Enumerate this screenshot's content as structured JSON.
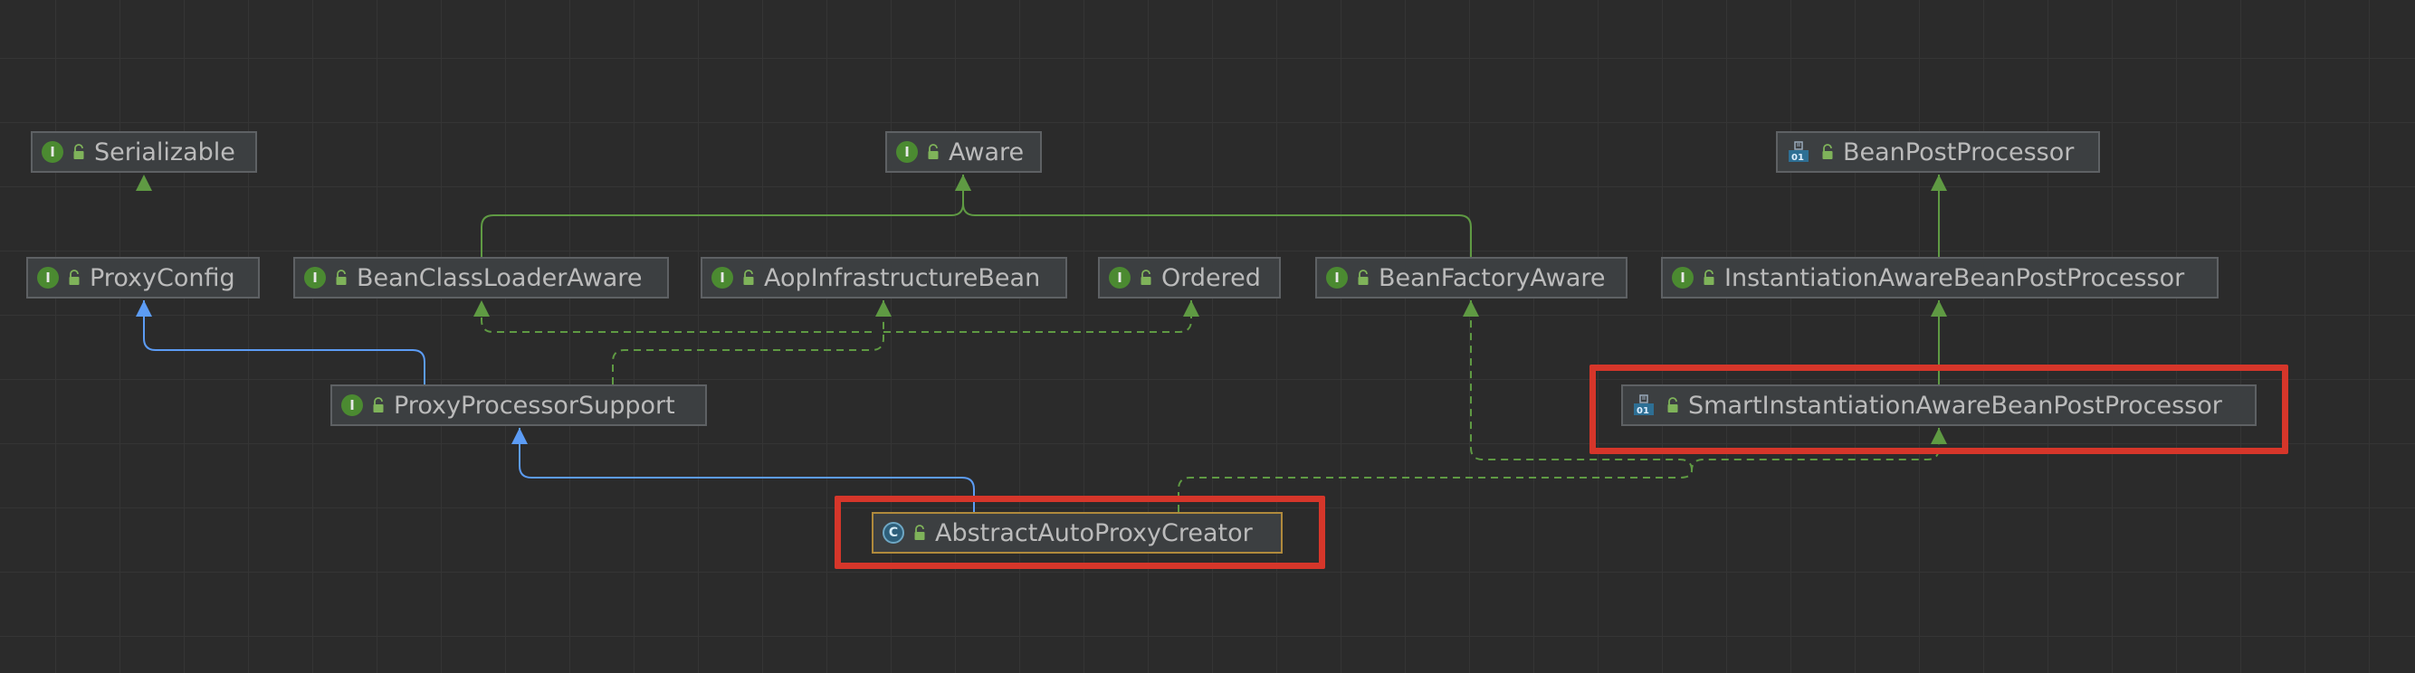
{
  "diagram": {
    "nodes": [
      {
        "id": "serializable",
        "label": "Serializable",
        "kind": "interface-icon"
      },
      {
        "id": "aware",
        "label": "Aware",
        "kind": "interface-icon"
      },
      {
        "id": "bean-post-processor",
        "label": "BeanPostProcessor",
        "kind": "functional-interface-icon"
      },
      {
        "id": "proxy-config",
        "label": "ProxyConfig",
        "kind": "interface-icon"
      },
      {
        "id": "bean-class-loader-aware",
        "label": "BeanClassLoaderAware",
        "kind": "interface-icon"
      },
      {
        "id": "aop-infrastructure-bean",
        "label": "AopInfrastructureBean",
        "kind": "interface-icon"
      },
      {
        "id": "ordered",
        "label": "Ordered",
        "kind": "interface-icon"
      },
      {
        "id": "bean-factory-aware",
        "label": "BeanFactoryAware",
        "kind": "interface-icon"
      },
      {
        "id": "instantiation-aware-bean-post-processor",
        "label": "InstantiationAwareBeanPostProcessor",
        "kind": "interface-icon"
      },
      {
        "id": "proxy-processor-support",
        "label": "ProxyProcessorSupport",
        "kind": "interface-icon"
      },
      {
        "id": "smart-instantiation-aware-bean-post-processor",
        "label": "SmartInstantiationAwareBeanPostProcessor",
        "kind": "functional-interface-icon"
      },
      {
        "id": "abstract-auto-proxy-creator",
        "label": "AbstractAutoProxyCreator",
        "kind": "abstract-class-icon"
      }
    ],
    "edges": [
      {
        "from": "proxy-config",
        "to": "serializable",
        "type": "implements"
      },
      {
        "from": "bean-class-loader-aware",
        "to": "aware",
        "type": "extends-interface"
      },
      {
        "from": "bean-factory-aware",
        "to": "aware",
        "type": "extends-interface"
      },
      {
        "from": "instantiation-aware-bean-post-processor",
        "to": "bean-post-processor",
        "type": "extends-interface"
      },
      {
        "from": "smart-instantiation-aware-bean-post-processor",
        "to": "instantiation-aware-bean-post-processor",
        "type": "extends-interface"
      },
      {
        "from": "proxy-processor-support",
        "to": "proxy-config",
        "type": "extends-class"
      },
      {
        "from": "proxy-processor-support",
        "to": "bean-class-loader-aware",
        "type": "implements"
      },
      {
        "from": "proxy-processor-support",
        "to": "aop-infrastructure-bean",
        "type": "implements"
      },
      {
        "from": "proxy-processor-support",
        "to": "ordered",
        "type": "implements"
      },
      {
        "from": "abstract-auto-proxy-creator",
        "to": "proxy-processor-support",
        "type": "extends-class"
      },
      {
        "from": "abstract-auto-proxy-creator",
        "to": "smart-instantiation-aware-bean-post-processor",
        "type": "implements"
      },
      {
        "from": "abstract-auto-proxy-creator",
        "to": "bean-factory-aware",
        "type": "implements"
      }
    ],
    "highlighted": [
      "smart-instantiation-aware-bean-post-processor",
      "abstract-auto-proxy-creator"
    ],
    "selected": "abstract-auto-proxy-creator",
    "colors": {
      "background": "#2b2b2b",
      "grid": "#353535",
      "node_fill": "#3c3f41",
      "node_border": "#5e6164",
      "node_text": "#bbbbbb",
      "interface_edge": "#5f9a43",
      "class_edge": "#5c9cf5",
      "highlight": "#d6362a",
      "selected_border": "#b08a3c"
    }
  }
}
